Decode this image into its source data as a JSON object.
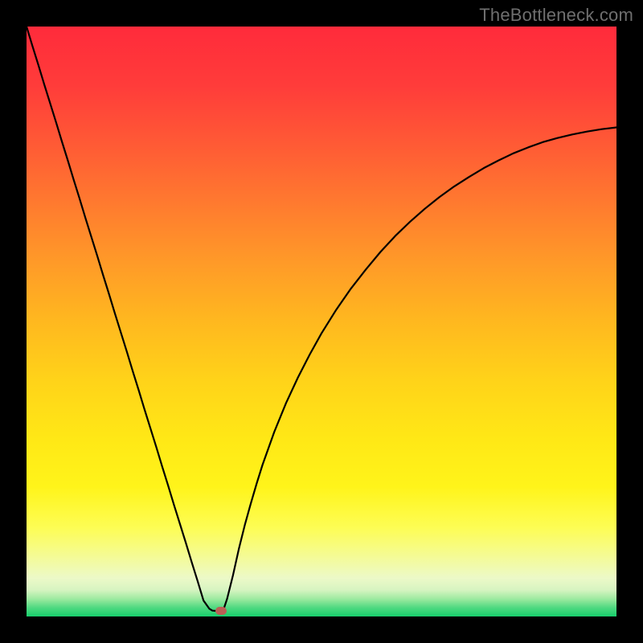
{
  "watermark": {
    "text": "TheBottleneck.com"
  },
  "colors": {
    "frame": "#000000",
    "marker": "#bb5f55",
    "curve": "#000000",
    "gradient_stops": [
      {
        "offset": 0.0,
        "color": "#ff2b3b"
      },
      {
        "offset": 0.1,
        "color": "#ff3c3a"
      },
      {
        "offset": 0.2,
        "color": "#ff5a35"
      },
      {
        "offset": 0.3,
        "color": "#ff7a2f"
      },
      {
        "offset": 0.4,
        "color": "#ff9a28"
      },
      {
        "offset": 0.5,
        "color": "#ffb81f"
      },
      {
        "offset": 0.6,
        "color": "#ffd319"
      },
      {
        "offset": 0.7,
        "color": "#ffe816"
      },
      {
        "offset": 0.78,
        "color": "#fff41a"
      },
      {
        "offset": 0.85,
        "color": "#fdfd55"
      },
      {
        "offset": 0.9,
        "color": "#f4fb98"
      },
      {
        "offset": 0.935,
        "color": "#ecf9c8"
      },
      {
        "offset": 0.955,
        "color": "#d7f4c1"
      },
      {
        "offset": 0.97,
        "color": "#9eeaa0"
      },
      {
        "offset": 0.985,
        "color": "#4fd981"
      },
      {
        "offset": 1.0,
        "color": "#17cf6c"
      }
    ]
  },
  "chart_data": {
    "type": "line",
    "title": "",
    "xlabel": "",
    "ylabel": "",
    "xlim": [
      0,
      100
    ],
    "ylim": [
      0,
      100
    ],
    "grid": false,
    "series": [
      {
        "name": "bottleneck-curve",
        "x": [
          0.0,
          1.0,
          2.0,
          3.0,
          4.0,
          5.0,
          6.0,
          7.0,
          8.0,
          9.0,
          10.0,
          11.0,
          12.0,
          13.0,
          14.0,
          15.0,
          16.0,
          17.0,
          18.0,
          19.0,
          20.0,
          21.0,
          22.0,
          23.0,
          24.0,
          25.0,
          26.0,
          27.0,
          28.0,
          29.0,
          30.0,
          31.0,
          31.5,
          32.0,
          32.5,
          33.0,
          33.5,
          34.0,
          35.0,
          36.0,
          37.0,
          38.0,
          39.0,
          40.0,
          42.0,
          44.0,
          46.0,
          48.0,
          50.0,
          52.5,
          55.0,
          57.5,
          60.0,
          62.5,
          65.0,
          67.5,
          70.0,
          72.5,
          75.0,
          77.5,
          80.0,
          82.5,
          85.0,
          87.5,
          90.0,
          92.5,
          95.0,
          97.5,
          100.0
        ],
        "y": [
          100.0,
          96.7,
          93.5,
          90.2,
          87.0,
          83.8,
          80.5,
          77.3,
          74.0,
          70.8,
          67.5,
          64.3,
          61.1,
          57.8,
          54.6,
          51.3,
          48.1,
          44.9,
          41.6,
          38.4,
          35.1,
          31.9,
          28.7,
          25.4,
          22.2,
          18.9,
          15.7,
          12.5,
          9.2,
          6.0,
          2.7,
          1.3,
          1.0,
          0.95,
          0.95,
          1.0,
          1.5,
          3.0,
          7.0,
          11.5,
          15.5,
          19.1,
          22.5,
          25.7,
          31.3,
          36.2,
          40.5,
          44.4,
          48.0,
          52.0,
          55.6,
          58.8,
          61.8,
          64.5,
          66.9,
          69.1,
          71.1,
          72.9,
          74.5,
          76.0,
          77.3,
          78.5,
          79.5,
          80.4,
          81.1,
          81.7,
          82.2,
          82.6,
          82.9
        ]
      }
    ],
    "marker": {
      "x": 33.0,
      "y": 1.0
    }
  }
}
